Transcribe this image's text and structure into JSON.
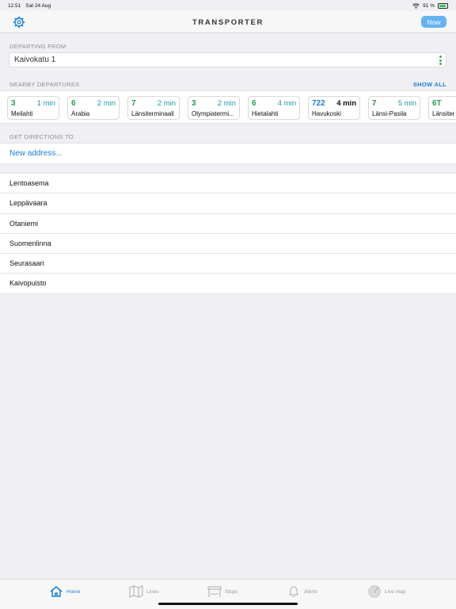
{
  "status": {
    "time": "12.51",
    "date": "Sat 24 Aug",
    "battery": "91 %"
  },
  "nav": {
    "title": "TRANSPORTER",
    "now_label": "Now",
    "settings_icon": "gear-icon"
  },
  "departing": {
    "header": "DEPARTING FROM",
    "value": "Kaivokatu 1"
  },
  "nearby": {
    "header": "NEARBY DEPARTURES",
    "show_all": "SHOW ALL",
    "cards": [
      {
        "line": "3",
        "time": "1 min",
        "stop": "Meilahti",
        "mode": "tram"
      },
      {
        "line": "6",
        "time": "2 min",
        "stop": "Arabia",
        "mode": "tram"
      },
      {
        "line": "7",
        "time": "2 min",
        "stop": "Länsiterminaali",
        "mode": "tram"
      },
      {
        "line": "3",
        "time": "2 min",
        "stop": "Olympiatermi...",
        "mode": "tram"
      },
      {
        "line": "6",
        "time": "4 min",
        "stop": "Hietalahti",
        "mode": "tram"
      },
      {
        "line": "722",
        "time": "4 min",
        "stop": "Havukoski",
        "mode": "bus"
      },
      {
        "line": "7",
        "time": "5 min",
        "stop": "Länsi-Pasila",
        "mode": "tram"
      },
      {
        "line": "6T",
        "time": "",
        "stop": "Länsiter",
        "mode": "tram"
      }
    ]
  },
  "directions": {
    "header": "GET DIRECTIONS TO",
    "new_address": "New address..."
  },
  "places": [
    "Lentoasema",
    "Leppävaara",
    "Otaniemi",
    "Suomenlinna",
    "Seurasaari",
    "Kaivopuisto"
  ],
  "tabs": [
    {
      "label": "Home",
      "icon": "home-icon"
    },
    {
      "label": "Lines",
      "icon": "map-icon"
    },
    {
      "label": "Stops",
      "icon": "stop-shelter-icon"
    },
    {
      "label": "Alerts",
      "icon": "bell-icon"
    },
    {
      "label": "Live map",
      "icon": "radar-icon"
    }
  ],
  "colors": {
    "accent": "#1a7ed6",
    "tram": "#2e9a4d",
    "minutes": "#1a9aa8",
    "now_button": "#63b4f0"
  }
}
